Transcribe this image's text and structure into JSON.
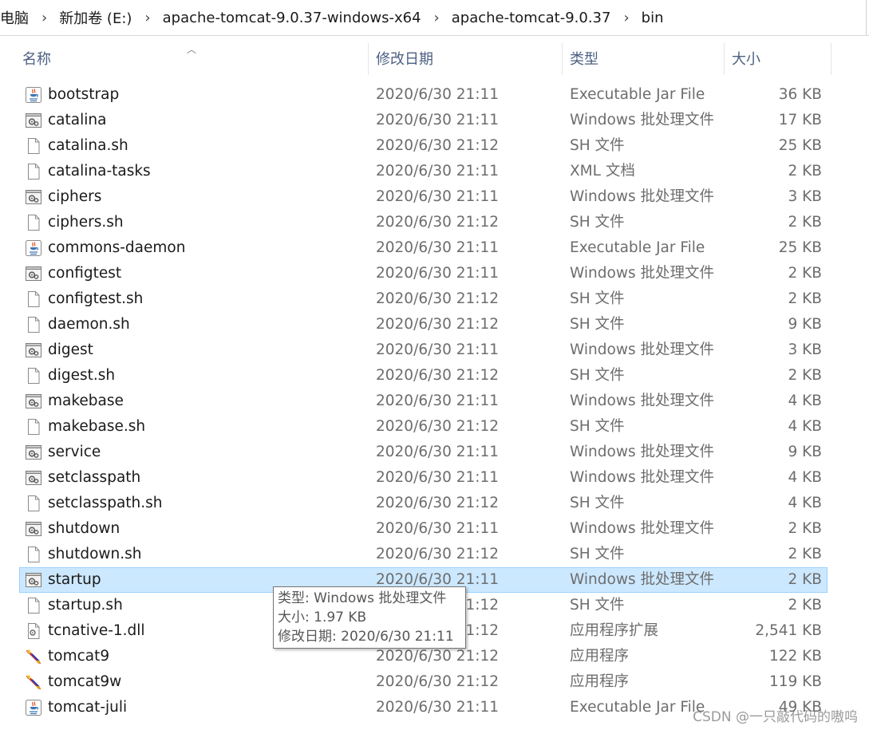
{
  "breadcrumb": {
    "items": [
      "电脑",
      "新加卷 (E:)",
      "apache-tomcat-9.0.37-windows-x64",
      "apache-tomcat-9.0.37",
      "bin"
    ]
  },
  "columns": {
    "name": "名称",
    "date": "修改日期",
    "type": "类型",
    "size": "大小"
  },
  "files": [
    {
      "name": "bootstrap",
      "date": "2020/6/30 21:11",
      "type": "Executable Jar File",
      "size": "36 KB",
      "icon": "java-jar-icon"
    },
    {
      "name": "catalina",
      "date": "2020/6/30 21:11",
      "type": "Windows 批处理文件",
      "size": "17 KB",
      "icon": "batch-file-icon"
    },
    {
      "name": "catalina.sh",
      "date": "2020/6/30 21:12",
      "type": "SH 文件",
      "size": "25 KB",
      "icon": "blank-file-icon"
    },
    {
      "name": "catalina-tasks",
      "date": "2020/6/30 21:11",
      "type": "XML 文档",
      "size": "2 KB",
      "icon": "blank-file-icon"
    },
    {
      "name": "ciphers",
      "date": "2020/6/30 21:11",
      "type": "Windows 批处理文件",
      "size": "3 KB",
      "icon": "batch-file-icon"
    },
    {
      "name": "ciphers.sh",
      "date": "2020/6/30 21:12",
      "type": "SH 文件",
      "size": "2 KB",
      "icon": "blank-file-icon"
    },
    {
      "name": "commons-daemon",
      "date": "2020/6/30 21:11",
      "type": "Executable Jar File",
      "size": "25 KB",
      "icon": "java-jar-icon"
    },
    {
      "name": "configtest",
      "date": "2020/6/30 21:11",
      "type": "Windows 批处理文件",
      "size": "2 KB",
      "icon": "batch-file-icon"
    },
    {
      "name": "configtest.sh",
      "date": "2020/6/30 21:12",
      "type": "SH 文件",
      "size": "2 KB",
      "icon": "blank-file-icon"
    },
    {
      "name": "daemon.sh",
      "date": "2020/6/30 21:12",
      "type": "SH 文件",
      "size": "9 KB",
      "icon": "blank-file-icon"
    },
    {
      "name": "digest",
      "date": "2020/6/30 21:11",
      "type": "Windows 批处理文件",
      "size": "3 KB",
      "icon": "batch-file-icon"
    },
    {
      "name": "digest.sh",
      "date": "2020/6/30 21:12",
      "type": "SH 文件",
      "size": "2 KB",
      "icon": "blank-file-icon"
    },
    {
      "name": "makebase",
      "date": "2020/6/30 21:11",
      "type": "Windows 批处理文件",
      "size": "4 KB",
      "icon": "batch-file-icon"
    },
    {
      "name": "makebase.sh",
      "date": "2020/6/30 21:12",
      "type": "SH 文件",
      "size": "4 KB",
      "icon": "blank-file-icon"
    },
    {
      "name": "service",
      "date": "2020/6/30 21:11",
      "type": "Windows 批处理文件",
      "size": "9 KB",
      "icon": "batch-file-icon"
    },
    {
      "name": "setclasspath",
      "date": "2020/6/30 21:11",
      "type": "Windows 批处理文件",
      "size": "4 KB",
      "icon": "batch-file-icon"
    },
    {
      "name": "setclasspath.sh",
      "date": "2020/6/30 21:12",
      "type": "SH 文件",
      "size": "4 KB",
      "icon": "blank-file-icon"
    },
    {
      "name": "shutdown",
      "date": "2020/6/30 21:11",
      "type": "Windows 批处理文件",
      "size": "2 KB",
      "icon": "batch-file-icon"
    },
    {
      "name": "shutdown.sh",
      "date": "2020/6/30 21:12",
      "type": "SH 文件",
      "size": "2 KB",
      "icon": "blank-file-icon"
    },
    {
      "name": "startup",
      "date": "2020/6/30 21:11",
      "type": "Windows 批处理文件",
      "size": "2 KB",
      "icon": "batch-file-icon",
      "selected": true
    },
    {
      "name": "startup.sh",
      "date": "2020/6/30 21:12",
      "type": "SH 文件",
      "size": "2 KB",
      "icon": "blank-file-icon"
    },
    {
      "name": "tcnative-1.dll",
      "date": "2020/6/30 21:12",
      "type": "应用程序扩展",
      "size": "2,541 KB",
      "icon": "dll-file-icon"
    },
    {
      "name": "tomcat9",
      "date": "2020/6/30 21:12",
      "type": "应用程序",
      "size": "122 KB",
      "icon": "tomcat-app-icon"
    },
    {
      "name": "tomcat9w",
      "date": "2020/6/30 21:12",
      "type": "应用程序",
      "size": "119 KB",
      "icon": "tomcat-app-icon"
    },
    {
      "name": "tomcat-juli",
      "date": "2020/6/30 21:11",
      "type": "Executable Jar File",
      "size": "49 KB",
      "icon": "java-jar-icon"
    }
  ],
  "tooltip": {
    "type_line": "类型: Windows 批处理文件",
    "size_line": "大小: 1.97 KB",
    "date_line": "修改日期: 2020/6/30 21:11"
  },
  "watermark": "CSDN @一只敲代码的嗷呜"
}
